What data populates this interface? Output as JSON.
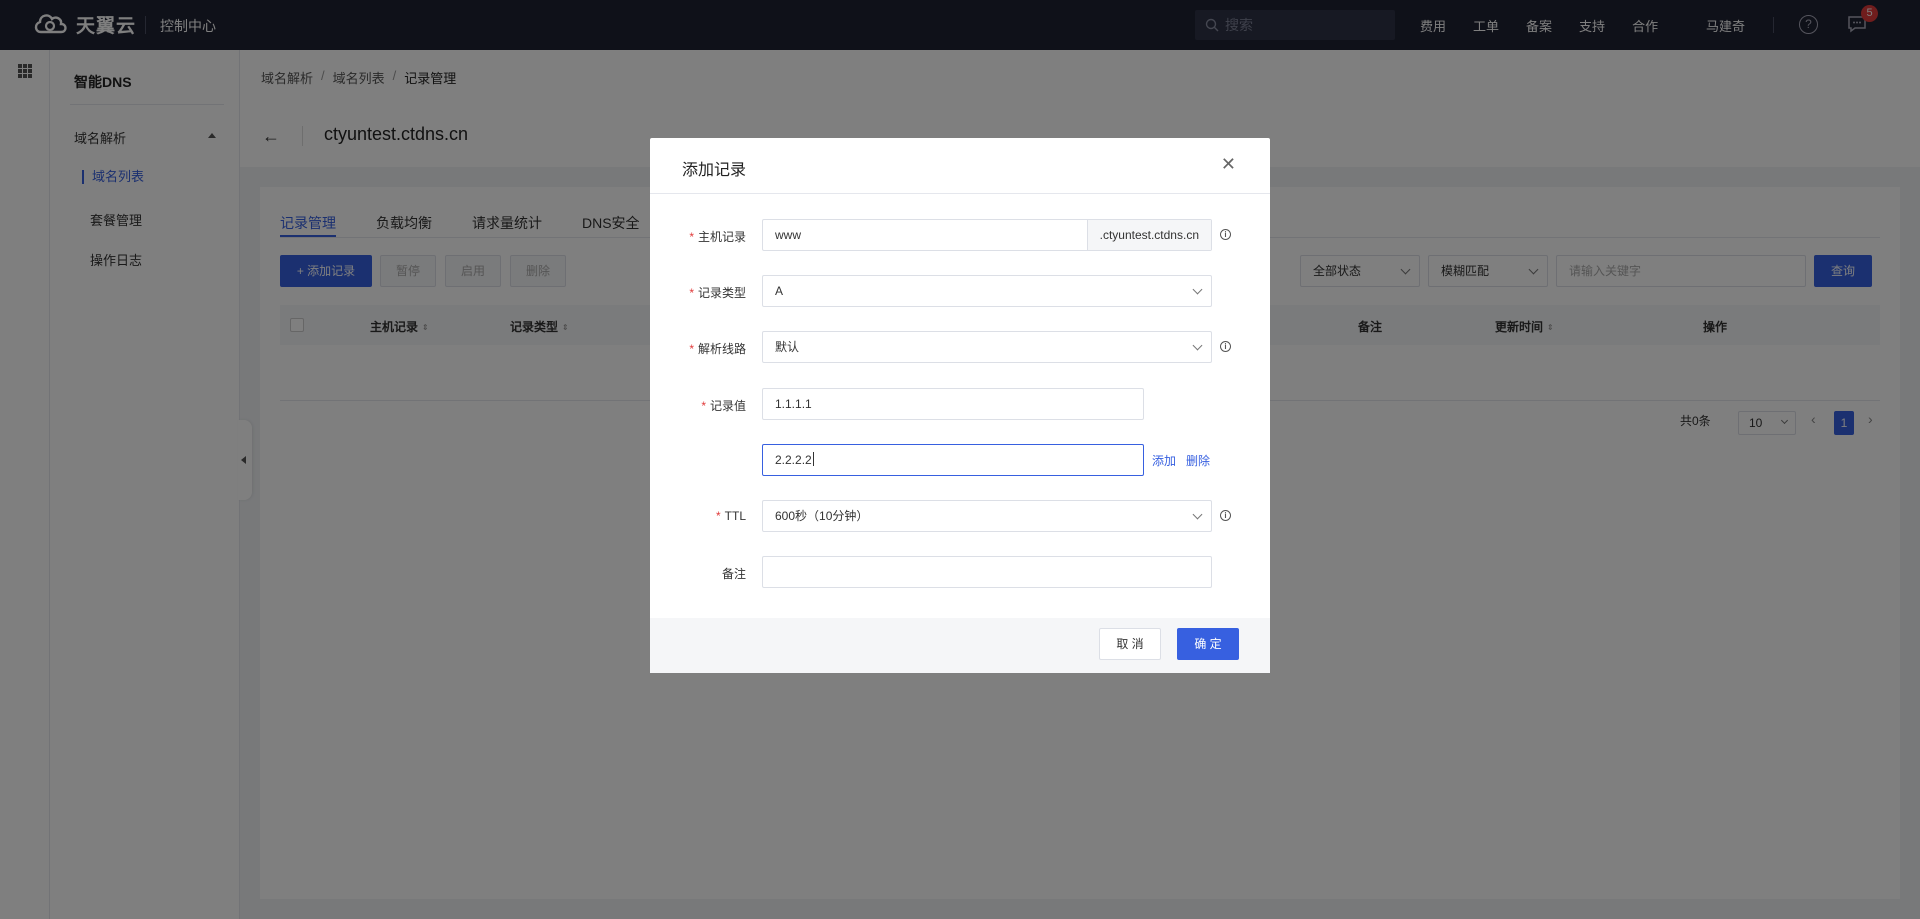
{
  "topbar": {
    "brand": "天翼云",
    "console": "控制中心",
    "search_placeholder": "搜索",
    "nav": [
      "费用",
      "工单",
      "备案",
      "支持",
      "合作"
    ],
    "user": "马建奇",
    "help_glyph": "?",
    "notification_count": "5"
  },
  "sidenav": {
    "title": "智能DNS",
    "group": "域名解析",
    "items": [
      "域名列表",
      "套餐管理",
      "操作日志"
    ]
  },
  "breadcrumb": [
    "域名解析",
    "域名列表",
    "记录管理"
  ],
  "breadcrumb_sep": "/",
  "domain": "ctyuntest.ctdns.cn",
  "back_glyph": "←",
  "tabs": [
    "记录管理",
    "负载均衡",
    "请求量统计",
    "DNS安全"
  ],
  "toolbar": {
    "add": "+ 添加记录",
    "pause": "暂停",
    "enable": "启用",
    "delete": "删除",
    "status_filter": "全部状态",
    "match_filter": "模糊匹配",
    "keyword_placeholder": "请输入关键字",
    "query": "查询"
  },
  "table": {
    "headers": [
      "主机记录",
      "记录类型",
      "备注",
      "更新时间",
      "操作"
    ],
    "sort_glyph": "⇕"
  },
  "pagination": {
    "total": "共0条",
    "page_size": "10",
    "current": "1",
    "prev_glyph": "‹",
    "next_glyph": "›"
  },
  "modal": {
    "title": "添加记录",
    "close_glyph": "✕",
    "info_glyph": "i",
    "required_mark": "*",
    "fields": {
      "host": {
        "label": "主机记录",
        "value": "www",
        "suffix": ".ctyuntest.ctdns.cn"
      },
      "type": {
        "label": "记录类型",
        "value": "A"
      },
      "line": {
        "label": "解析线路",
        "value": "默认"
      },
      "values": {
        "label": "记录值",
        "items": [
          "1.1.1.1",
          "2.2.2.2"
        ]
      },
      "ttl": {
        "label": "TTL",
        "value": "600秒（10分钟）"
      },
      "remark": {
        "label": "备注",
        "value": ""
      }
    },
    "add_link": "添加",
    "delete_link": "删除",
    "cancel": "取 消",
    "ok": "确 定"
  },
  "colors": {
    "primary": "#3760e0",
    "topbar": "#1f2233",
    "danger": "#e03a3a"
  }
}
